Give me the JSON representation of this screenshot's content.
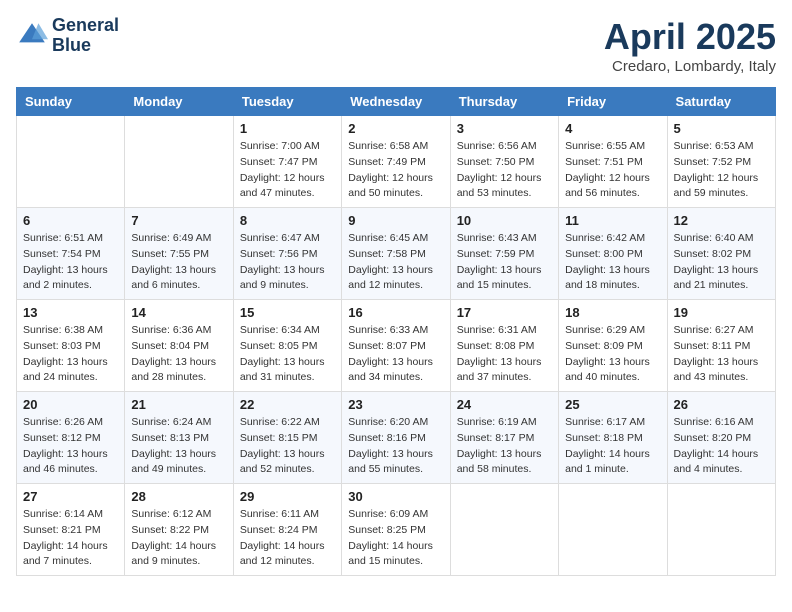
{
  "header": {
    "logo_line1": "General",
    "logo_line2": "Blue",
    "month_title": "April 2025",
    "location": "Credaro, Lombardy, Italy"
  },
  "weekdays": [
    "Sunday",
    "Monday",
    "Tuesday",
    "Wednesday",
    "Thursday",
    "Friday",
    "Saturday"
  ],
  "weeks": [
    [
      {
        "day": "",
        "sunrise": "",
        "sunset": "",
        "daylight": ""
      },
      {
        "day": "",
        "sunrise": "",
        "sunset": "",
        "daylight": ""
      },
      {
        "day": "1",
        "sunrise": "Sunrise: 7:00 AM",
        "sunset": "Sunset: 7:47 PM",
        "daylight": "Daylight: 12 hours and 47 minutes."
      },
      {
        "day": "2",
        "sunrise": "Sunrise: 6:58 AM",
        "sunset": "Sunset: 7:49 PM",
        "daylight": "Daylight: 12 hours and 50 minutes."
      },
      {
        "day": "3",
        "sunrise": "Sunrise: 6:56 AM",
        "sunset": "Sunset: 7:50 PM",
        "daylight": "Daylight: 12 hours and 53 minutes."
      },
      {
        "day": "4",
        "sunrise": "Sunrise: 6:55 AM",
        "sunset": "Sunset: 7:51 PM",
        "daylight": "Daylight: 12 hours and 56 minutes."
      },
      {
        "day": "5",
        "sunrise": "Sunrise: 6:53 AM",
        "sunset": "Sunset: 7:52 PM",
        "daylight": "Daylight: 12 hours and 59 minutes."
      }
    ],
    [
      {
        "day": "6",
        "sunrise": "Sunrise: 6:51 AM",
        "sunset": "Sunset: 7:54 PM",
        "daylight": "Daylight: 13 hours and 2 minutes."
      },
      {
        "day": "7",
        "sunrise": "Sunrise: 6:49 AM",
        "sunset": "Sunset: 7:55 PM",
        "daylight": "Daylight: 13 hours and 6 minutes."
      },
      {
        "day": "8",
        "sunrise": "Sunrise: 6:47 AM",
        "sunset": "Sunset: 7:56 PM",
        "daylight": "Daylight: 13 hours and 9 minutes."
      },
      {
        "day": "9",
        "sunrise": "Sunrise: 6:45 AM",
        "sunset": "Sunset: 7:58 PM",
        "daylight": "Daylight: 13 hours and 12 minutes."
      },
      {
        "day": "10",
        "sunrise": "Sunrise: 6:43 AM",
        "sunset": "Sunset: 7:59 PM",
        "daylight": "Daylight: 13 hours and 15 minutes."
      },
      {
        "day": "11",
        "sunrise": "Sunrise: 6:42 AM",
        "sunset": "Sunset: 8:00 PM",
        "daylight": "Daylight: 13 hours and 18 minutes."
      },
      {
        "day": "12",
        "sunrise": "Sunrise: 6:40 AM",
        "sunset": "Sunset: 8:02 PM",
        "daylight": "Daylight: 13 hours and 21 minutes."
      }
    ],
    [
      {
        "day": "13",
        "sunrise": "Sunrise: 6:38 AM",
        "sunset": "Sunset: 8:03 PM",
        "daylight": "Daylight: 13 hours and 24 minutes."
      },
      {
        "day": "14",
        "sunrise": "Sunrise: 6:36 AM",
        "sunset": "Sunset: 8:04 PM",
        "daylight": "Daylight: 13 hours and 28 minutes."
      },
      {
        "day": "15",
        "sunrise": "Sunrise: 6:34 AM",
        "sunset": "Sunset: 8:05 PM",
        "daylight": "Daylight: 13 hours and 31 minutes."
      },
      {
        "day": "16",
        "sunrise": "Sunrise: 6:33 AM",
        "sunset": "Sunset: 8:07 PM",
        "daylight": "Daylight: 13 hours and 34 minutes."
      },
      {
        "day": "17",
        "sunrise": "Sunrise: 6:31 AM",
        "sunset": "Sunset: 8:08 PM",
        "daylight": "Daylight: 13 hours and 37 minutes."
      },
      {
        "day": "18",
        "sunrise": "Sunrise: 6:29 AM",
        "sunset": "Sunset: 8:09 PM",
        "daylight": "Daylight: 13 hours and 40 minutes."
      },
      {
        "day": "19",
        "sunrise": "Sunrise: 6:27 AM",
        "sunset": "Sunset: 8:11 PM",
        "daylight": "Daylight: 13 hours and 43 minutes."
      }
    ],
    [
      {
        "day": "20",
        "sunrise": "Sunrise: 6:26 AM",
        "sunset": "Sunset: 8:12 PM",
        "daylight": "Daylight: 13 hours and 46 minutes."
      },
      {
        "day": "21",
        "sunrise": "Sunrise: 6:24 AM",
        "sunset": "Sunset: 8:13 PM",
        "daylight": "Daylight: 13 hours and 49 minutes."
      },
      {
        "day": "22",
        "sunrise": "Sunrise: 6:22 AM",
        "sunset": "Sunset: 8:15 PM",
        "daylight": "Daylight: 13 hours and 52 minutes."
      },
      {
        "day": "23",
        "sunrise": "Sunrise: 6:20 AM",
        "sunset": "Sunset: 8:16 PM",
        "daylight": "Daylight: 13 hours and 55 minutes."
      },
      {
        "day": "24",
        "sunrise": "Sunrise: 6:19 AM",
        "sunset": "Sunset: 8:17 PM",
        "daylight": "Daylight: 13 hours and 58 minutes."
      },
      {
        "day": "25",
        "sunrise": "Sunrise: 6:17 AM",
        "sunset": "Sunset: 8:18 PM",
        "daylight": "Daylight: 14 hours and 1 minute."
      },
      {
        "day": "26",
        "sunrise": "Sunrise: 6:16 AM",
        "sunset": "Sunset: 8:20 PM",
        "daylight": "Daylight: 14 hours and 4 minutes."
      }
    ],
    [
      {
        "day": "27",
        "sunrise": "Sunrise: 6:14 AM",
        "sunset": "Sunset: 8:21 PM",
        "daylight": "Daylight: 14 hours and 7 minutes."
      },
      {
        "day": "28",
        "sunrise": "Sunrise: 6:12 AM",
        "sunset": "Sunset: 8:22 PM",
        "daylight": "Daylight: 14 hours and 9 minutes."
      },
      {
        "day": "29",
        "sunrise": "Sunrise: 6:11 AM",
        "sunset": "Sunset: 8:24 PM",
        "daylight": "Daylight: 14 hours and 12 minutes."
      },
      {
        "day": "30",
        "sunrise": "Sunrise: 6:09 AM",
        "sunset": "Sunset: 8:25 PM",
        "daylight": "Daylight: 14 hours and 15 minutes."
      },
      {
        "day": "",
        "sunrise": "",
        "sunset": "",
        "daylight": ""
      },
      {
        "day": "",
        "sunrise": "",
        "sunset": "",
        "daylight": ""
      },
      {
        "day": "",
        "sunrise": "",
        "sunset": "",
        "daylight": ""
      }
    ]
  ]
}
